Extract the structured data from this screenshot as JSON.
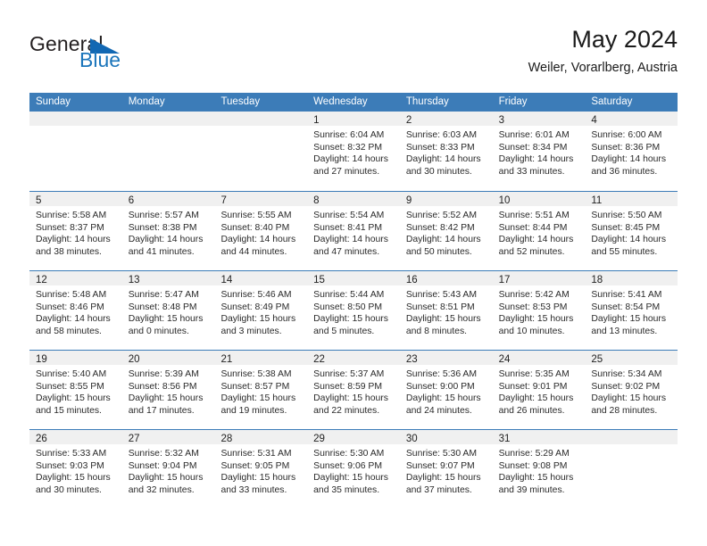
{
  "brand": {
    "name_top": "General",
    "name_bottom": "Blue",
    "color_dark": "#231f20",
    "color_blue": "#1b75bb"
  },
  "header": {
    "month_title": "May 2024",
    "location": "Weiler, Vorarlberg, Austria"
  },
  "theme": {
    "header_blue": "#3c7cb8",
    "daynum_band": "#f0f0f0",
    "text": "#2a2a2a"
  },
  "weekdays": [
    "Sunday",
    "Monday",
    "Tuesday",
    "Wednesday",
    "Thursday",
    "Friday",
    "Saturday"
  ],
  "labels": {
    "sunrise_prefix": "Sunrise:",
    "sunset_prefix": "Sunset:",
    "daylight_prefix": "Daylight:"
  },
  "weeks": [
    [
      {
        "day": "",
        "sunrise": "",
        "sunset": "",
        "daylight_line1": "",
        "daylight_line2": ""
      },
      {
        "day": "",
        "sunrise": "",
        "sunset": "",
        "daylight_line1": "",
        "daylight_line2": ""
      },
      {
        "day": "",
        "sunrise": "",
        "sunset": "",
        "daylight_line1": "",
        "daylight_line2": ""
      },
      {
        "day": "1",
        "sunrise": "Sunrise: 6:04 AM",
        "sunset": "Sunset: 8:32 PM",
        "daylight_line1": "Daylight: 14 hours",
        "daylight_line2": "and 27 minutes."
      },
      {
        "day": "2",
        "sunrise": "Sunrise: 6:03 AM",
        "sunset": "Sunset: 8:33 PM",
        "daylight_line1": "Daylight: 14 hours",
        "daylight_line2": "and 30 minutes."
      },
      {
        "day": "3",
        "sunrise": "Sunrise: 6:01 AM",
        "sunset": "Sunset: 8:34 PM",
        "daylight_line1": "Daylight: 14 hours",
        "daylight_line2": "and 33 minutes."
      },
      {
        "day": "4",
        "sunrise": "Sunrise: 6:00 AM",
        "sunset": "Sunset: 8:36 PM",
        "daylight_line1": "Daylight: 14 hours",
        "daylight_line2": "and 36 minutes."
      }
    ],
    [
      {
        "day": "5",
        "sunrise": "Sunrise: 5:58 AM",
        "sunset": "Sunset: 8:37 PM",
        "daylight_line1": "Daylight: 14 hours",
        "daylight_line2": "and 38 minutes."
      },
      {
        "day": "6",
        "sunrise": "Sunrise: 5:57 AM",
        "sunset": "Sunset: 8:38 PM",
        "daylight_line1": "Daylight: 14 hours",
        "daylight_line2": "and 41 minutes."
      },
      {
        "day": "7",
        "sunrise": "Sunrise: 5:55 AM",
        "sunset": "Sunset: 8:40 PM",
        "daylight_line1": "Daylight: 14 hours",
        "daylight_line2": "and 44 minutes."
      },
      {
        "day": "8",
        "sunrise": "Sunrise: 5:54 AM",
        "sunset": "Sunset: 8:41 PM",
        "daylight_line1": "Daylight: 14 hours",
        "daylight_line2": "and 47 minutes."
      },
      {
        "day": "9",
        "sunrise": "Sunrise: 5:52 AM",
        "sunset": "Sunset: 8:42 PM",
        "daylight_line1": "Daylight: 14 hours",
        "daylight_line2": "and 50 minutes."
      },
      {
        "day": "10",
        "sunrise": "Sunrise: 5:51 AM",
        "sunset": "Sunset: 8:44 PM",
        "daylight_line1": "Daylight: 14 hours",
        "daylight_line2": "and 52 minutes."
      },
      {
        "day": "11",
        "sunrise": "Sunrise: 5:50 AM",
        "sunset": "Sunset: 8:45 PM",
        "daylight_line1": "Daylight: 14 hours",
        "daylight_line2": "and 55 minutes."
      }
    ],
    [
      {
        "day": "12",
        "sunrise": "Sunrise: 5:48 AM",
        "sunset": "Sunset: 8:46 PM",
        "daylight_line1": "Daylight: 14 hours",
        "daylight_line2": "and 58 minutes."
      },
      {
        "day": "13",
        "sunrise": "Sunrise: 5:47 AM",
        "sunset": "Sunset: 8:48 PM",
        "daylight_line1": "Daylight: 15 hours",
        "daylight_line2": "and 0 minutes."
      },
      {
        "day": "14",
        "sunrise": "Sunrise: 5:46 AM",
        "sunset": "Sunset: 8:49 PM",
        "daylight_line1": "Daylight: 15 hours",
        "daylight_line2": "and 3 minutes."
      },
      {
        "day": "15",
        "sunrise": "Sunrise: 5:44 AM",
        "sunset": "Sunset: 8:50 PM",
        "daylight_line1": "Daylight: 15 hours",
        "daylight_line2": "and 5 minutes."
      },
      {
        "day": "16",
        "sunrise": "Sunrise: 5:43 AM",
        "sunset": "Sunset: 8:51 PM",
        "daylight_line1": "Daylight: 15 hours",
        "daylight_line2": "and 8 minutes."
      },
      {
        "day": "17",
        "sunrise": "Sunrise: 5:42 AM",
        "sunset": "Sunset: 8:53 PM",
        "daylight_line1": "Daylight: 15 hours",
        "daylight_line2": "and 10 minutes."
      },
      {
        "day": "18",
        "sunrise": "Sunrise: 5:41 AM",
        "sunset": "Sunset: 8:54 PM",
        "daylight_line1": "Daylight: 15 hours",
        "daylight_line2": "and 13 minutes."
      }
    ],
    [
      {
        "day": "19",
        "sunrise": "Sunrise: 5:40 AM",
        "sunset": "Sunset: 8:55 PM",
        "daylight_line1": "Daylight: 15 hours",
        "daylight_line2": "and 15 minutes."
      },
      {
        "day": "20",
        "sunrise": "Sunrise: 5:39 AM",
        "sunset": "Sunset: 8:56 PM",
        "daylight_line1": "Daylight: 15 hours",
        "daylight_line2": "and 17 minutes."
      },
      {
        "day": "21",
        "sunrise": "Sunrise: 5:38 AM",
        "sunset": "Sunset: 8:57 PM",
        "daylight_line1": "Daylight: 15 hours",
        "daylight_line2": "and 19 minutes."
      },
      {
        "day": "22",
        "sunrise": "Sunrise: 5:37 AM",
        "sunset": "Sunset: 8:59 PM",
        "daylight_line1": "Daylight: 15 hours",
        "daylight_line2": "and 22 minutes."
      },
      {
        "day": "23",
        "sunrise": "Sunrise: 5:36 AM",
        "sunset": "Sunset: 9:00 PM",
        "daylight_line1": "Daylight: 15 hours",
        "daylight_line2": "and 24 minutes."
      },
      {
        "day": "24",
        "sunrise": "Sunrise: 5:35 AM",
        "sunset": "Sunset: 9:01 PM",
        "daylight_line1": "Daylight: 15 hours",
        "daylight_line2": "and 26 minutes."
      },
      {
        "day": "25",
        "sunrise": "Sunrise: 5:34 AM",
        "sunset": "Sunset: 9:02 PM",
        "daylight_line1": "Daylight: 15 hours",
        "daylight_line2": "and 28 minutes."
      }
    ],
    [
      {
        "day": "26",
        "sunrise": "Sunrise: 5:33 AM",
        "sunset": "Sunset: 9:03 PM",
        "daylight_line1": "Daylight: 15 hours",
        "daylight_line2": "and 30 minutes."
      },
      {
        "day": "27",
        "sunrise": "Sunrise: 5:32 AM",
        "sunset": "Sunset: 9:04 PM",
        "daylight_line1": "Daylight: 15 hours",
        "daylight_line2": "and 32 minutes."
      },
      {
        "day": "28",
        "sunrise": "Sunrise: 5:31 AM",
        "sunset": "Sunset: 9:05 PM",
        "daylight_line1": "Daylight: 15 hours",
        "daylight_line2": "and 33 minutes."
      },
      {
        "day": "29",
        "sunrise": "Sunrise: 5:30 AM",
        "sunset": "Sunset: 9:06 PM",
        "daylight_line1": "Daylight: 15 hours",
        "daylight_line2": "and 35 minutes."
      },
      {
        "day": "30",
        "sunrise": "Sunrise: 5:30 AM",
        "sunset": "Sunset: 9:07 PM",
        "daylight_line1": "Daylight: 15 hours",
        "daylight_line2": "and 37 minutes."
      },
      {
        "day": "31",
        "sunrise": "Sunrise: 5:29 AM",
        "sunset": "Sunset: 9:08 PM",
        "daylight_line1": "Daylight: 15 hours",
        "daylight_line2": "and 39 minutes."
      },
      {
        "day": "",
        "sunrise": "",
        "sunset": "",
        "daylight_line1": "",
        "daylight_line2": ""
      }
    ]
  ]
}
